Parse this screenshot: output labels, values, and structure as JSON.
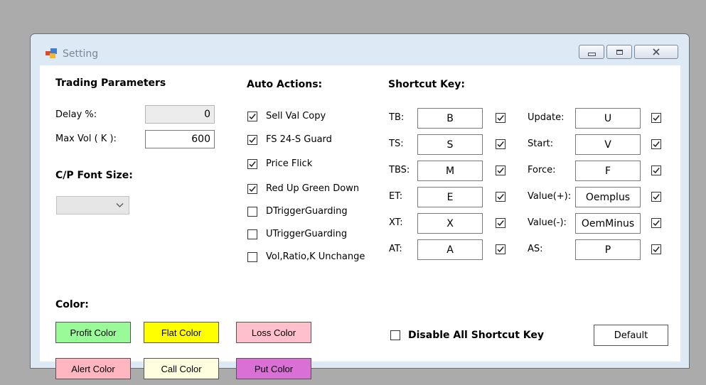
{
  "window": {
    "title": "Setting"
  },
  "trading": {
    "heading": "Trading Parameters",
    "delay_label": "Delay %:",
    "delay_value": "0",
    "maxvol_label": "Max Vol ( K ):",
    "maxvol_value": "600",
    "font_heading": "C/P Font Size:",
    "font_value": ""
  },
  "auto": {
    "heading": "Auto Actions:",
    "items": [
      {
        "label": "Sell Val Copy",
        "checked": true
      },
      {
        "label": "FS 24-S Guard",
        "checked": true
      },
      {
        "label": "Price Flick",
        "checked": true
      },
      {
        "label": "Red Up Green Down",
        "checked": true
      },
      {
        "label": "DTriggerGuarding",
        "checked": false
      },
      {
        "label": "UTriggerGuarding",
        "checked": false
      },
      {
        "label": "Vol,Ratio,K Unchange",
        "checked": false
      }
    ]
  },
  "shortcut": {
    "heading": "Shortcut Key:",
    "left": [
      {
        "label": "TB:",
        "key": "B",
        "checked": true
      },
      {
        "label": "TS:",
        "key": "S",
        "checked": true
      },
      {
        "label": "TBS:",
        "key": "M",
        "checked": true
      },
      {
        "label": "ET:",
        "key": "E",
        "checked": true
      },
      {
        "label": "XT:",
        "key": "X",
        "checked": true
      },
      {
        "label": "AT:",
        "key": "A",
        "checked": true
      }
    ],
    "right": [
      {
        "label": "Update:",
        "key": "U",
        "checked": true
      },
      {
        "label": "Start:",
        "key": "V",
        "checked": true
      },
      {
        "label": "Force:",
        "key": "F",
        "checked": true
      },
      {
        "label": "Value(+):",
        "key": "Oemplus",
        "checked": true
      },
      {
        "label": "Value(-):",
        "key": "OemMinus",
        "checked": true
      },
      {
        "label": "AS:",
        "key": "P",
        "checked": true
      }
    ],
    "disable_label": "Disable All Shortcut Key",
    "disable_checked": false,
    "default_label": "Default"
  },
  "color": {
    "heading": "Color:",
    "buttons": [
      {
        "label": "Profit Color",
        "bg": "#98fb98"
      },
      {
        "label": "Flat Color",
        "bg": "#ffff00"
      },
      {
        "label": "Loss Color",
        "bg": "#ffc0cb"
      },
      {
        "label": "Alert Color",
        "bg": "#ffb6c1"
      },
      {
        "label": "Call Color",
        "bg": "#ffffe0"
      },
      {
        "label": "Put Color",
        "bg": "#da70d6"
      }
    ]
  }
}
